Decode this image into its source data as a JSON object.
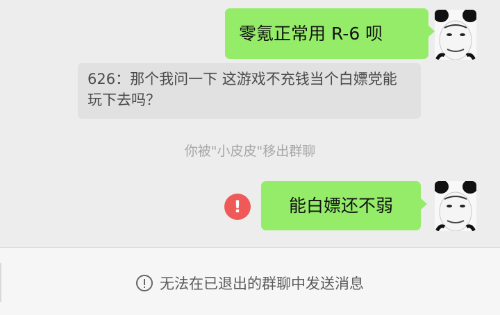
{
  "messages": [
    {
      "type": "outgoing",
      "text": "零氪正常用 R-6 呗",
      "quoted_reply": "626：那个我问一下 这游戏不充钱当个白嫖党能玩下去吗？"
    },
    {
      "type": "system",
      "text": "你被\"小皮皮\"移出群聊"
    },
    {
      "type": "outgoing",
      "text": "能白嫖还不弱",
      "status": "failed",
      "status_icon": "exclamation-icon"
    }
  ],
  "footer": {
    "notice": "无法在已退出的群聊中发送消息",
    "icon": "info-icon"
  },
  "colors": {
    "outgoing_bubble": "#95ec69",
    "quote_box": "#e1e1e1",
    "error": "#ef5a58",
    "background": "#ededed"
  }
}
